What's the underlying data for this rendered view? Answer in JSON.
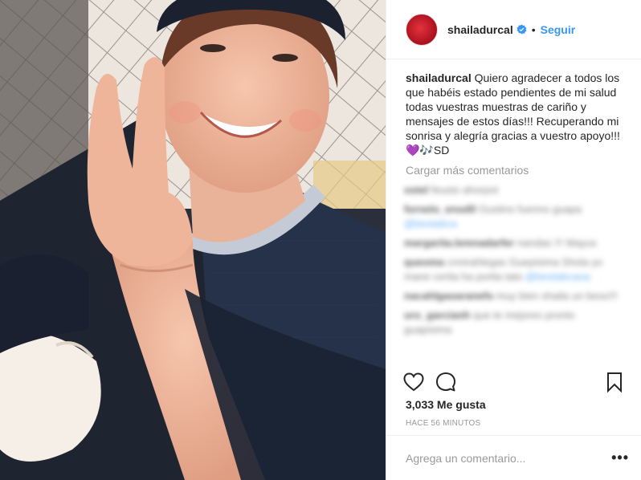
{
  "post": {
    "username": "shailadurcal",
    "verified": true,
    "separator": "•",
    "follow_label": "Seguir",
    "caption_user": "shailadurcal",
    "caption_text": "Quiero agradecer a todos los que habéis estado pendientes de mi salud todas vuestras muestras de cariño y mensajes de estos días!!! Recuperando mi sonrisa y alegría gracias a vuestro apoyo!!!",
    "caption_emoji": "💜🎶",
    "caption_sign": "SD",
    "load_more": "Cargar más comentarios",
    "likes": "3,033 Me gusta",
    "time": "HACE 56 MINUTOS",
    "comment_placeholder": "Agrega un comentario...",
    "more_label": "•••"
  },
  "comments": [
    {
      "user": "ostel",
      "text": "feusto ahorpot"
    },
    {
      "user": "fornelo_enod0",
      "text": "Gustino fuenno guapa",
      "tag": "@bestabca"
    },
    {
      "user": "margarita.lemnadarfer",
      "text": "nandas !!! Mayus"
    },
    {
      "user": "queoma",
      "text": "cnnirahlegas Guepisima Shola yo mane cerita ha porita tato",
      "tag": "@bestabcaoa"
    },
    {
      "user": "nacahlgaoaranefo",
      "text": "muy bien shaila un beso!!!"
    },
    {
      "user": "uro_garcianh",
      "text": "que te mejores pronto guapisima"
    }
  ],
  "colors": {
    "link": "#3897f0",
    "text": "#262626",
    "muted": "#999999",
    "avatar": "#c81e2b",
    "verified": "#3897f0"
  },
  "icons": {
    "like": "heart-outline-icon",
    "comment": "speech-bubble-icon",
    "save": "bookmark-icon",
    "verified": "verified-badge-icon"
  }
}
